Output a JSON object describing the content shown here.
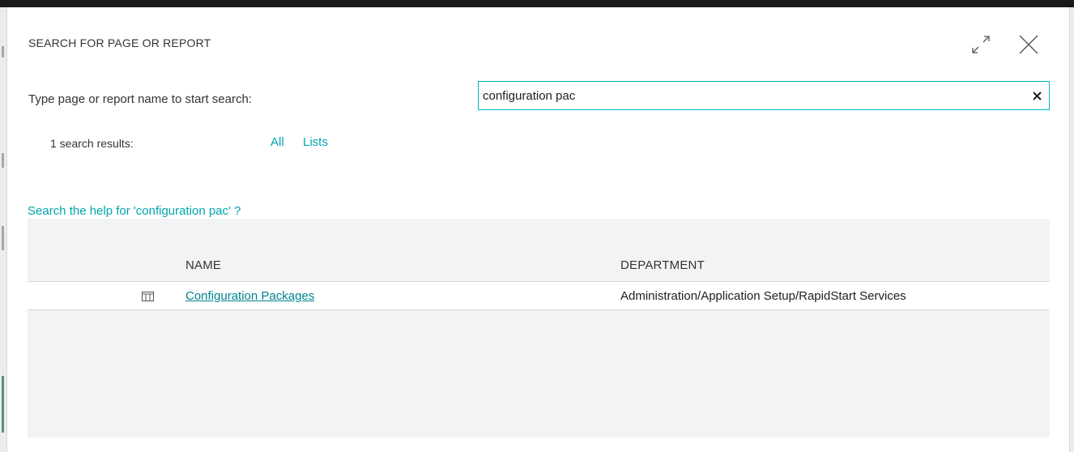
{
  "dialog": {
    "title": "SEARCH FOR PAGE OR REPORT",
    "expand_icon": "expand-diagonal-icon",
    "close_icon": "close-icon"
  },
  "search": {
    "label": "Type page or report name to start search:",
    "value": "configuration pac",
    "clear_icon": "clear-x-icon"
  },
  "results": {
    "count_text": "1 search results:",
    "filters": [
      "All",
      "Lists"
    ],
    "help_link": "Search the help for 'configuration pac' ?",
    "columns": {
      "name": "NAME",
      "department": "DEPARTMENT"
    },
    "rows": [
      {
        "icon": "list-page-icon",
        "name": "Configuration Packages",
        "department": "Administration/Application Setup/RapidStart Services"
      }
    ]
  },
  "colors": {
    "accent": "#00a5b0",
    "link": "#00838f",
    "panel_bg": "#f2f3f4",
    "input_border": "#00b7c3"
  }
}
